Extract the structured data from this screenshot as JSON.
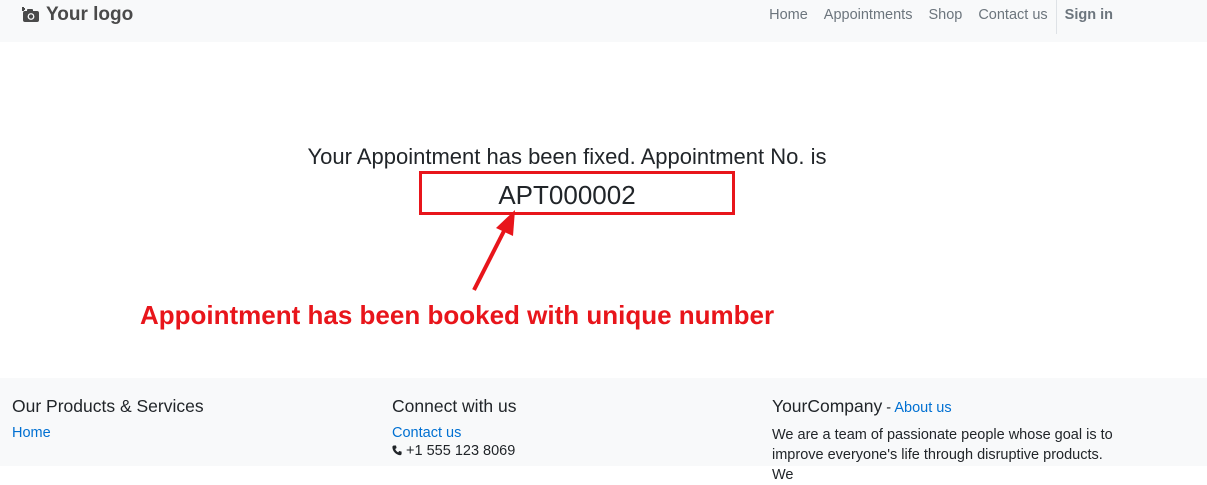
{
  "header": {
    "logo_text": "Your logo",
    "logo_icon": "camera-icon",
    "nav": [
      "Home",
      "Appointments",
      "Shop",
      "Contact us"
    ],
    "signin": "Sign in"
  },
  "main": {
    "message": "Your Appointment has been fixed. Appointment No. is",
    "appointment_no": "APT000002"
  },
  "annotation": {
    "text": "Appointment has been booked with unique number",
    "color": "#e8151b"
  },
  "footer": {
    "col1": {
      "title": "Our Products & Services",
      "link": "Home"
    },
    "col2": {
      "title": "Connect with us",
      "link": "Contact us",
      "phone": "+1 555 123 8069",
      "phone_icon": "phone-icon"
    },
    "col3": {
      "title": "YourCompany",
      "sep": " - ",
      "link": "About us",
      "text": "We are a team of passionate people whose goal is to improve everyone's life through disruptive products. We"
    }
  },
  "colors": {
    "accent": "#0070d2",
    "annotation": "#e8151b",
    "navbar_bg": "#f8f9fa"
  }
}
